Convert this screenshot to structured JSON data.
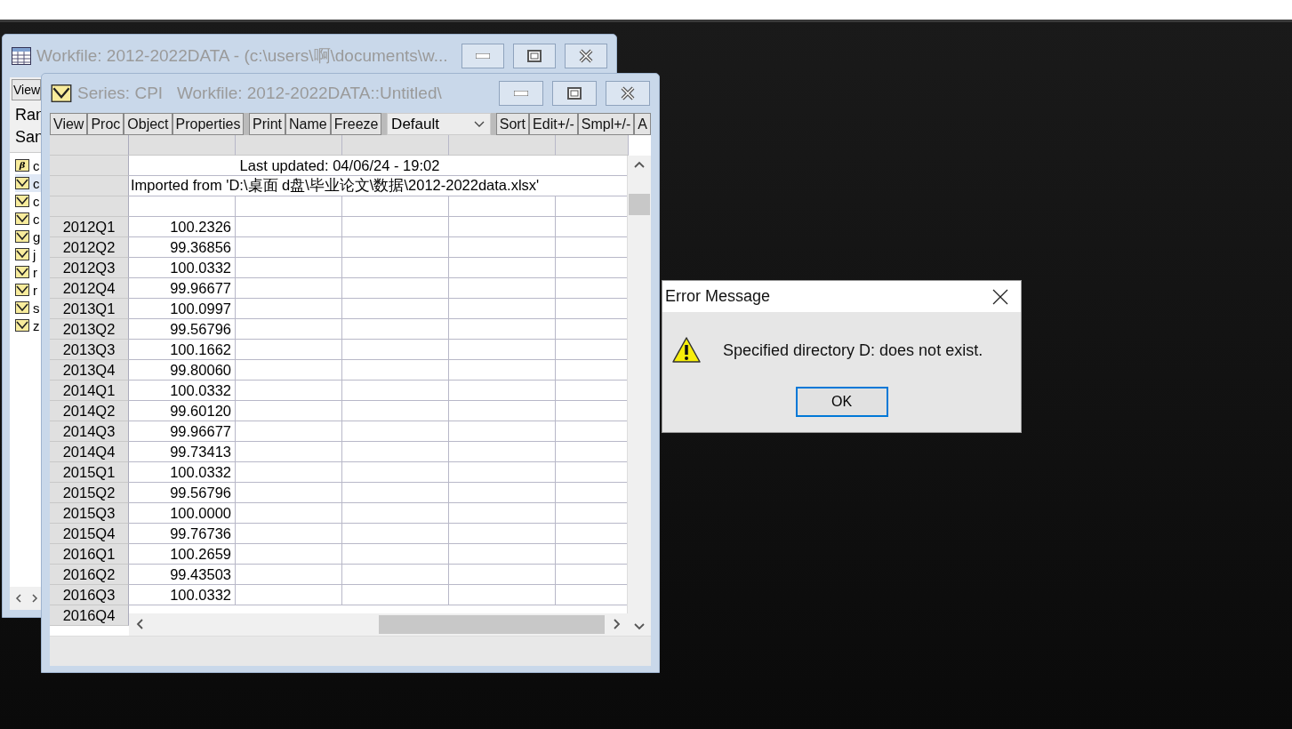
{
  "workfile_window": {
    "title": "Workfile: 2012-2022DATA - (c:\\users\\啊\\documents\\w...",
    "toolbar": [
      "View"
    ],
    "info_labels": [
      "Ran",
      "San"
    ],
    "objects": [
      {
        "kind": "coef",
        "icon_text": "β",
        "name": "c",
        "selected": false
      },
      {
        "kind": "series",
        "name": "c",
        "selected": true
      },
      {
        "kind": "series",
        "name": "c",
        "selected": false
      },
      {
        "kind": "series",
        "name": "c",
        "selected": false
      },
      {
        "kind": "series",
        "name": "g",
        "selected": false
      },
      {
        "kind": "series",
        "name": "j",
        "selected": false
      },
      {
        "kind": "series",
        "name": "r",
        "selected": false
      },
      {
        "kind": "series",
        "name": "r",
        "selected": false
      },
      {
        "kind": "series",
        "name": "s",
        "selected": false
      },
      {
        "kind": "series",
        "name": "z",
        "selected": false
      }
    ]
  },
  "series_window": {
    "title": "Series: CPI   Workfile: 2012-2022DATA::Untitled\\",
    "toolbar": [
      {
        "kind": "button",
        "label": "View"
      },
      {
        "kind": "button",
        "label": "Proc"
      },
      {
        "kind": "button",
        "label": "Object"
      },
      {
        "kind": "button",
        "label": "Properties"
      },
      {
        "kind": "separator"
      },
      {
        "kind": "button",
        "label": "Print"
      },
      {
        "kind": "button",
        "label": "Name"
      },
      {
        "kind": "button",
        "label": "Freeze"
      },
      {
        "kind": "separator"
      },
      {
        "kind": "dropdown",
        "label": "Default"
      },
      {
        "kind": "separator"
      },
      {
        "kind": "button",
        "label": "Sort"
      },
      {
        "kind": "button",
        "label": "Edit+/-"
      },
      {
        "kind": "button",
        "label": "Smpl+/-"
      },
      {
        "kind": "button",
        "label": "A"
      }
    ],
    "notes": [
      "Last updated: 04/06/24 - 19:02",
      "Imported from 'D:\\桌面 d盘\\毕业论文\\数据\\2012-2022data.xlsx'"
    ],
    "rows": [
      {
        "period": "2012Q1",
        "value": "100.2326"
      },
      {
        "period": "2012Q2",
        "value": "99.36856"
      },
      {
        "period": "2012Q3",
        "value": "100.0332"
      },
      {
        "period": "2012Q4",
        "value": "99.96677"
      },
      {
        "period": "2013Q1",
        "value": "100.0997"
      },
      {
        "period": "2013Q2",
        "value": "99.56796"
      },
      {
        "period": "2013Q3",
        "value": "100.1662"
      },
      {
        "period": "2013Q4",
        "value": "99.80060"
      },
      {
        "period": "2014Q1",
        "value": "100.0332"
      },
      {
        "period": "2014Q2",
        "value": "99.60120"
      },
      {
        "period": "2014Q3",
        "value": "99.96677"
      },
      {
        "period": "2014Q4",
        "value": "99.73413"
      },
      {
        "period": "2015Q1",
        "value": "100.0332"
      },
      {
        "period": "2015Q2",
        "value": "99.56796"
      },
      {
        "period": "2015Q3",
        "value": "100.0000"
      },
      {
        "period": "2015Q4",
        "value": "99.76736"
      },
      {
        "period": "2016Q1",
        "value": "100.2659"
      },
      {
        "period": "2016Q2",
        "value": "99.43503"
      },
      {
        "period": "2016Q3",
        "value": "100.0332"
      },
      {
        "period": "2016Q4"
      }
    ]
  },
  "error_dialog": {
    "title": "Error Message",
    "message": "Specified directory D: does not exist.",
    "buttons": [
      "OK"
    ]
  }
}
